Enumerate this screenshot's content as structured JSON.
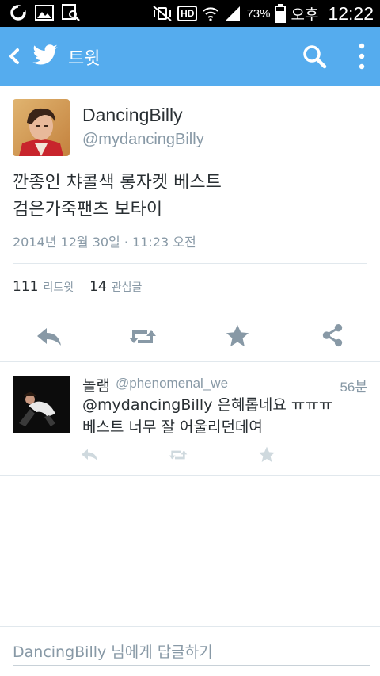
{
  "status_bar": {
    "battery_percent": "73%",
    "ampm": "오후",
    "time": "12:22",
    "hd_label": "HD"
  },
  "app_bar": {
    "title": "트윗",
    "color": "#55acee"
  },
  "tweet": {
    "display_name": "DancingBilly",
    "handle": "@mydancingBilly",
    "text_line1": "깐종인 챠콜색 롱자켓 베스트",
    "text_line2": "검은가죽팬츠 보타이",
    "timestamp": "2014년 12월 30일 · 11:23 오전",
    "retweets_count": "111",
    "retweets_label": "리트윗",
    "favorites_count": "14",
    "favorites_label": "관심글"
  },
  "reply": {
    "display_name": "놀램",
    "handle": "@phenomenal_we",
    "time_ago": "56분",
    "text_line1": "@mydancingBilly 은혜롭네요 ㅠㅠㅠ",
    "text_line2": "베스트 너무 잘 어울리던데여"
  },
  "composer": {
    "placeholder": "DancingBilly 님에게 답글하기"
  },
  "colors": {
    "accent": "#55acee",
    "icon_gray": "#8899a6",
    "icon_light": "#cfd9de"
  }
}
